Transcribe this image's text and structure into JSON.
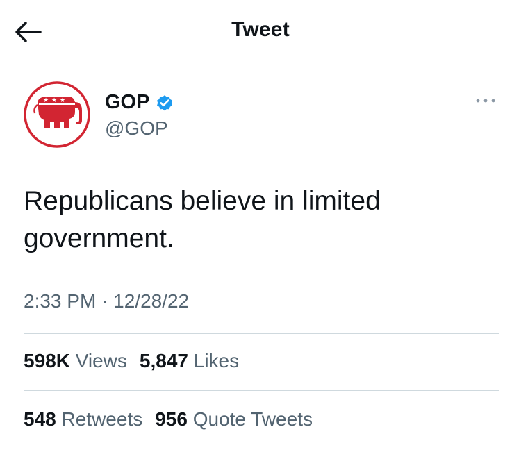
{
  "header": {
    "title": "Tweet",
    "back_icon": "arrow-left-icon"
  },
  "author": {
    "name": "GOP",
    "handle": "@GOP",
    "verified": true,
    "avatar_icon": "republican-elephant-logo",
    "more_icon": "more-dots-icon"
  },
  "tweet": {
    "text_line1": "Republicans believe in limited",
    "text_line2": "government.",
    "time": "2:33 PM",
    "separator": "·",
    "date": "12/28/22"
  },
  "stats": {
    "views_count": "598K",
    "views_label": "Views",
    "likes_count": "5,847",
    "likes_label": "Likes",
    "retweets_count": "548",
    "retweets_label": "Retweets",
    "quotes_count": "956",
    "quotes_label": "Quote Tweets"
  },
  "colors": {
    "text": "#0f1419",
    "secondary": "#536471",
    "verified": "#1d9bf0",
    "gop_red": "#d22532",
    "divider": "#cfd9de"
  }
}
